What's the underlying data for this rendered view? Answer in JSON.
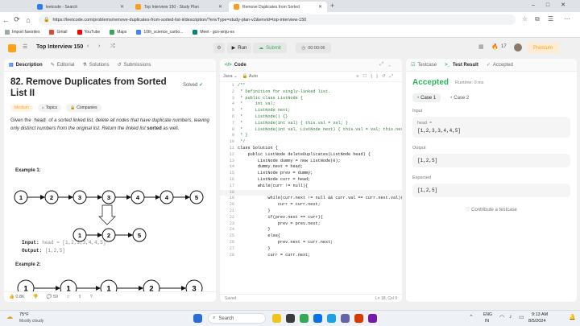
{
  "browser": {
    "tabs": [
      {
        "title": "leetcode - Search"
      },
      {
        "title": "Top Interview 150 - Study Plan"
      },
      {
        "title": "Remove Duplicates from Sorted"
      }
    ],
    "url": "https://leetcode.com/problems/remove-duplicates-from-sorted-list-ii/description/?envType=study-plan-v2&envId=top-interview-150",
    "bookmarks": [
      "Import favorites",
      "Gmail",
      "YouTube",
      "Maps",
      "10th_science_carbo...",
      "Meet - gcn-wnju-es"
    ]
  },
  "header": {
    "list_name": "Top Interview 150",
    "run_label": "Run",
    "submit_label": "Submit",
    "timer": "00:00:06",
    "streak": "17",
    "premium_label": "Premium"
  },
  "description_panel": {
    "tabs": [
      "Description",
      "Editorial",
      "Solutions",
      "Submissions"
    ],
    "title": "82. Remove Duplicates from Sorted List II",
    "solved": "Solved",
    "difficulty": "Medium",
    "topics": "Topics",
    "companies": "Companies",
    "text_prefix": "Given the ",
    "text_code": "head",
    "text_mid": " of a sorted linked list, delete all nodes that have duplicate numbers, leaving only distinct numbers from the original list. Return the linked list ",
    "text_bold": "sorted",
    "text_suffix": " as well.",
    "example1_title": "Example 1:",
    "example1_input_label": "Input:",
    "example1_input": "head = [1,2,3,3,4,4,5]",
    "example1_output_label": "Output:",
    "example1_output": "[1,2,5]",
    "example2_title": "Example 2:",
    "diagram1_row1": [
      "1",
      "2",
      "3",
      "3",
      "4",
      "4",
      "5"
    ],
    "diagram1_row2": [
      "1",
      "2",
      "5"
    ],
    "diagram2_row": [
      "1",
      "1",
      "1",
      "2",
      "3"
    ],
    "likes": "0.8K",
    "comments": "59"
  },
  "code_panel": {
    "title": "Code",
    "language": "Java",
    "mode": "Auto",
    "lines": [
      "/**",
      " * Definition for singly-linked list.",
      " * public class ListNode {",
      " *     int val;",
      " *     ListNode next;",
      " *     ListNode() {}",
      " *     ListNode(int val) { this.val = val; }",
      " *     ListNode(int val, ListNode next) { this.val = val; this.next = next; }",
      " * }",
      " */",
      "class Solution {",
      "    public ListNode deleteDuplicates(ListNode head) {",
      "        ListNode dummy = new ListNode(0);",
      "        dummy.next = head;",
      "        ListNode prev = dummy;",
      "        ListNode curr = head;",
      "        while(curr != null){",
      "",
      "            while(curr.next != null && curr.val == curr.next.val){",
      "                curr = curr.next;",
      "            }",
      "            if(prev.next == curr){",
      "                prev = prev.next;",
      "            }",
      "            else{",
      "                prev.next = curr.next;",
      "            }",
      "            curr = curr.next;"
    ],
    "saved": "Saved",
    "cursor": "Ln 18, Col 9"
  },
  "test_panel": {
    "tabs": [
      "Testcase",
      "Test Result",
      "Accepted"
    ],
    "status": "Accepted",
    "runtime": "Runtime: 0 ms",
    "cases": [
      "Case 1",
      "Case 2"
    ],
    "input_label": "Input",
    "input_name": "head =",
    "input_value": "[1,2,3,3,4,4,5]",
    "output_label": "Output",
    "output_value": "[1,2,5]",
    "expected_label": "Expected",
    "expected_value": "[1,2,5]",
    "contribute": "Contribute a testcase"
  },
  "taskbar": {
    "weather_temp": "75°F",
    "weather_desc": "Mostly cloudy",
    "search": "Search",
    "lang1": "ENG",
    "lang2": "IN",
    "time": "9:13 AM",
    "date": "8/5/2024"
  },
  "colors": {
    "accepted": "#2db55d",
    "medium": "#ffa116",
    "submit": "#2db55d",
    "premium": "#ffa116"
  }
}
